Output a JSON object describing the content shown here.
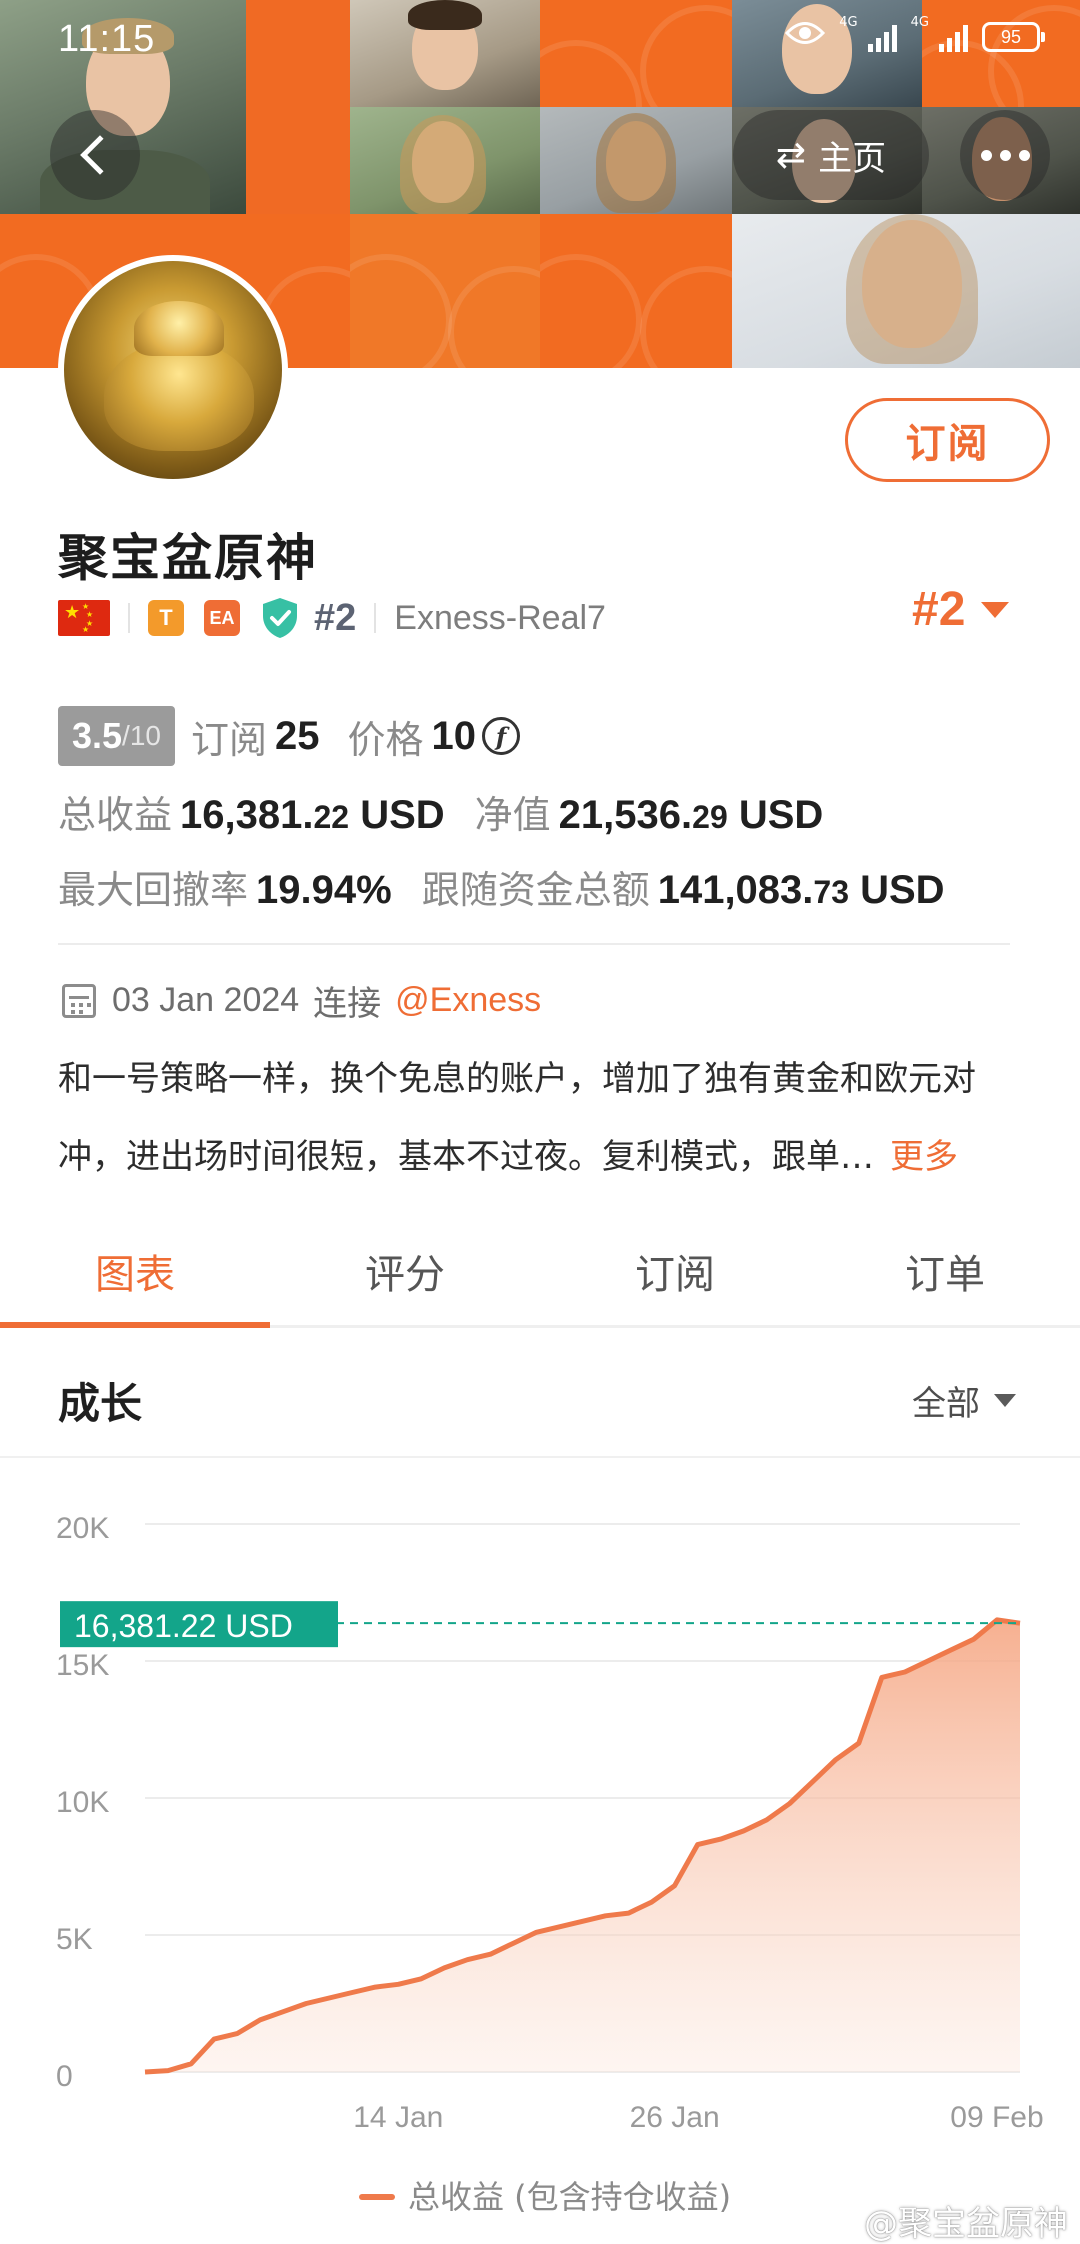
{
  "status_bar": {
    "time": "11:15",
    "network_1": "4G",
    "network_2": "4G",
    "battery": "95"
  },
  "header": {
    "home_label": "主页",
    "swap_icon": "⇄"
  },
  "profile": {
    "name": "聚宝盆原神",
    "subscribe_label": "订阅",
    "badge_t": "T",
    "badge_ea": "EA",
    "rank_small": "#2",
    "server": "Exness-Real7",
    "rank_big": "#2"
  },
  "stats": {
    "score": "3.5",
    "score_max": "/10",
    "subscribe_label": "订阅",
    "subscribe_count": "25",
    "price_label": "价格",
    "price_value": "10",
    "price_coin": "f",
    "total_profit_label": "总收益",
    "total_profit_main": "16,381.",
    "total_profit_cents": "22",
    "total_profit_unit": " USD",
    "equity_label": "净值",
    "equity_main": "21,536.",
    "equity_cents": "29",
    "equity_unit": " USD",
    "drawdown_label": "最大回撤率",
    "drawdown_value": "19.94%",
    "follow_label": "跟随资金总额",
    "follow_main": "141,083.",
    "follow_cents": "73",
    "follow_unit": " USD"
  },
  "connection": {
    "date": "03 Jan 2024",
    "word": "连接",
    "broker": "@Exness"
  },
  "description": {
    "line1": "和一号策略一样，换个免息的账户，增加了独有黄金和欧元对",
    "line2": "冲，进出场时间很短，基本不过夜。复利模式，跟单…",
    "more": "更多"
  },
  "tabs": [
    {
      "label": "图表",
      "active": true
    },
    {
      "label": "评分",
      "active": false
    },
    {
      "label": "订阅",
      "active": false
    },
    {
      "label": "订单",
      "active": false
    }
  ],
  "growth": {
    "title": "成长",
    "range": "全部"
  },
  "chart_data": {
    "type": "area",
    "title": "",
    "current_label": "16,381.22 USD",
    "y_ticks": [
      "20K",
      "15K",
      "10K",
      "5K",
      "0"
    ],
    "x_ticks": [
      "14 Jan",
      "26 Jan",
      "09 Feb"
    ],
    "ylim": [
      0,
      20000
    ],
    "grid": true,
    "legend_position": "bottom",
    "colors": {
      "line": "#ef7a4b",
      "fill": "#f6b89c",
      "marker": "#13a58a"
    },
    "series": [
      {
        "name": "总收益 (包含持仓收益)",
        "x": [
          "03 Jan",
          "04 Jan",
          "05 Jan",
          "06 Jan",
          "07 Jan",
          "08 Jan",
          "09 Jan",
          "10 Jan",
          "11 Jan",
          "12 Jan",
          "13 Jan",
          "14 Jan",
          "15 Jan",
          "16 Jan",
          "17 Jan",
          "18 Jan",
          "19 Jan",
          "20 Jan",
          "21 Jan",
          "22 Jan",
          "23 Jan",
          "24 Jan",
          "25 Jan",
          "26 Jan",
          "27 Jan",
          "28 Jan",
          "29 Jan",
          "30 Jan",
          "31 Jan",
          "01 Feb",
          "02 Feb",
          "03 Feb",
          "04 Feb",
          "05 Feb",
          "06 Feb",
          "07 Feb",
          "08 Feb",
          "09 Feb",
          "10 Feb"
        ],
        "values": [
          0,
          50,
          300,
          1200,
          1400,
          1900,
          2200,
          2500,
          2700,
          2900,
          3100,
          3200,
          3400,
          3800,
          4100,
          4300,
          4700,
          5100,
          5300,
          5500,
          5700,
          5800,
          6200,
          6800,
          8300,
          8500,
          8800,
          9200,
          9800,
          10600,
          11400,
          12000,
          14400,
          14600,
          15000,
          15400,
          15800,
          16500,
          16381
        ]
      }
    ],
    "legend": [
      "总收益 (包含持仓收益)"
    ]
  },
  "watermark": "@聚宝盆原神"
}
